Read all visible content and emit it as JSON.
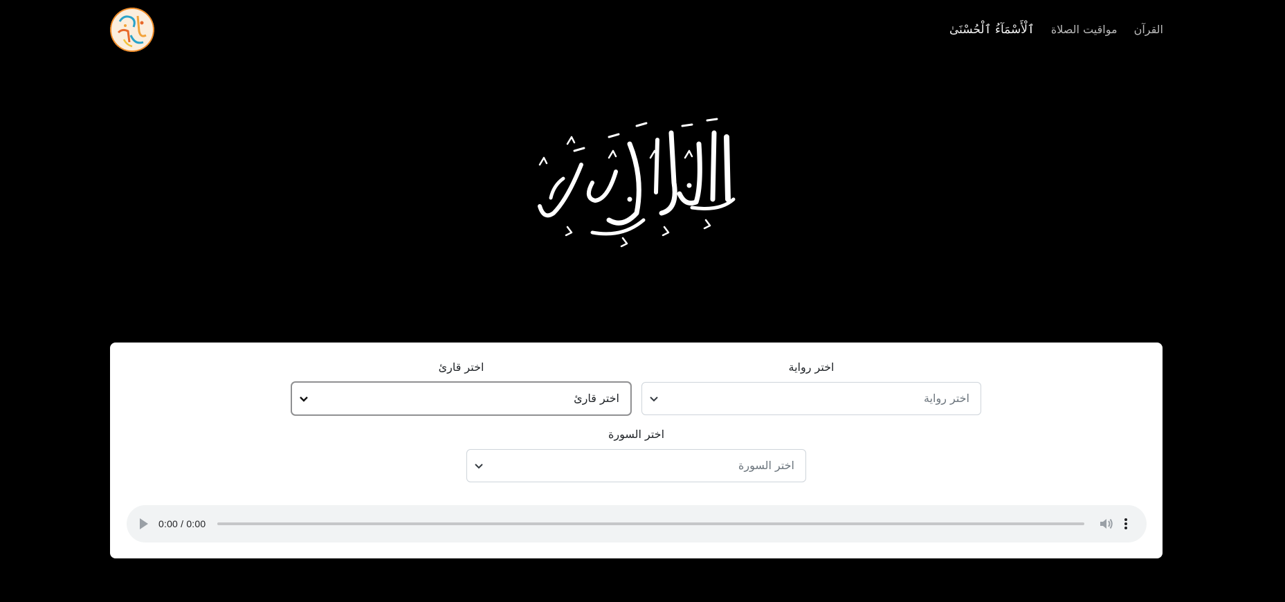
{
  "nav": {
    "links": [
      {
        "label": "ٱلْأَسْمَآءُ ٱلْحُسْنَىٰ"
      },
      {
        "label": "مواقيت الصلاة"
      },
      {
        "label": "القرآن"
      }
    ]
  },
  "hero": {
    "title": "القرآن الكريم"
  },
  "form": {
    "riwaya": {
      "label": "اختر رواية",
      "value": "اختر رواية"
    },
    "qari": {
      "label": "اختر قارئ",
      "value": "اختر قارئ"
    },
    "surah": {
      "label": "اختر السورة",
      "value": "اختر السورة"
    }
  },
  "player": {
    "time": "0:00 / 0:00",
    "progress": 0
  },
  "colors": {
    "background": "#000000",
    "card": "#ffffff",
    "player": "#f1f3f4"
  }
}
